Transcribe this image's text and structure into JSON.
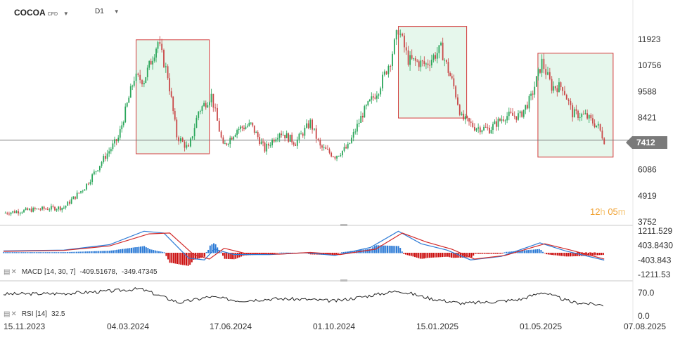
{
  "header": {
    "symbol": "COCOA",
    "symbol_suffix": "CFD",
    "timeframe": "D1"
  },
  "price_tag": "7412",
  "timer": {
    "hours": "12",
    "h_unit": "h",
    "minutes": "05",
    "m_unit": "m"
  },
  "macd_label": {
    "name": "MACD [14, 30, 7]",
    "v1": "-409.51678,",
    "v2": "-349.47345"
  },
  "rsi_label": {
    "name": "RSI [14]",
    "value": "32.5"
  },
  "colors": {
    "up": "#2aa65a",
    "down": "#c94848",
    "box_fill": "#e6f7ec",
    "box_stroke": "#d23a3a",
    "macd_line": "#2d7bd6",
    "signal_line": "#d12a2a",
    "hist_pos": "#2d7bd6",
    "hist_neg": "#cc1111",
    "rsi_line": "#222222"
  },
  "chart_data": [
    {
      "type": "candlestick",
      "title": "COCOA",
      "x_tick_labels": [
        "15.11.2023",
        "04.03.2024",
        "17.06.2024",
        "01.10.2024",
        "15.01.2025",
        "01.05.2025",
        "07.08.2025"
      ],
      "y_ticks": [
        11923,
        10756,
        9588,
        8421,
        7412,
        6086,
        4919,
        3752
      ],
      "ylim": [
        3752,
        12700
      ],
      "current_price": 7412,
      "close_series": [
        {
          "date": "2023-11-15",
          "close": 4150
        },
        {
          "date": "2023-12-15",
          "close": 4300
        },
        {
          "date": "2024-01-15",
          "close": 4400
        },
        {
          "date": "2024-02-05",
          "close": 5300
        },
        {
          "date": "2024-02-26",
          "close": 6700
        },
        {
          "date": "2024-03-10",
          "close": 7500
        },
        {
          "date": "2024-03-26",
          "close": 10200
        },
        {
          "date": "2024-04-05",
          "close": 10100
        },
        {
          "date": "2024-04-19",
          "close": 11800
        },
        {
          "date": "2024-04-29",
          "close": 10300
        },
        {
          "date": "2024-05-08",
          "close": 7600
        },
        {
          "date": "2024-05-20",
          "close": 7000
        },
        {
          "date": "2024-05-30",
          "close": 8700
        },
        {
          "date": "2024-06-12",
          "close": 9400
        },
        {
          "date": "2024-06-24",
          "close": 7100
        },
        {
          "date": "2024-07-08",
          "close": 7900
        },
        {
          "date": "2024-07-22",
          "close": 8100
        },
        {
          "date": "2024-08-05",
          "close": 7000
        },
        {
          "date": "2024-08-20",
          "close": 7800
        },
        {
          "date": "2024-09-05",
          "close": 7300
        },
        {
          "date": "2024-09-20",
          "close": 8200
        },
        {
          "date": "2024-09-30",
          "close": 7100
        },
        {
          "date": "2024-10-15",
          "close": 6700
        },
        {
          "date": "2024-10-28",
          "close": 7100
        },
        {
          "date": "2024-11-12",
          "close": 8600
        },
        {
          "date": "2024-11-28",
          "close": 9700
        },
        {
          "date": "2024-12-10",
          "close": 11000
        },
        {
          "date": "2024-12-18",
          "close": 12400
        },
        {
          "date": "2024-12-28",
          "close": 11000
        },
        {
          "date": "2025-01-15",
          "close": 10800
        },
        {
          "date": "2025-01-30",
          "close": 11500
        },
        {
          "date": "2025-02-12",
          "close": 9800
        },
        {
          "date": "2025-02-20",
          "close": 8400
        },
        {
          "date": "2025-03-05",
          "close": 8000
        },
        {
          "date": "2025-03-20",
          "close": 7900
        },
        {
          "date": "2025-04-05",
          "close": 8500
        },
        {
          "date": "2025-04-20",
          "close": 8500
        },
        {
          "date": "2025-05-01",
          "close": 9300
        },
        {
          "date": "2025-05-12",
          "close": 10900
        },
        {
          "date": "2025-05-22",
          "close": 9800
        },
        {
          "date": "2025-06-02",
          "close": 9800
        },
        {
          "date": "2025-06-12",
          "close": 8600
        },
        {
          "date": "2025-06-25",
          "close": 8500
        },
        {
          "date": "2025-07-08",
          "close": 8000
        },
        {
          "date": "2025-07-14",
          "close": 7412
        }
      ],
      "highlight_boxes": [
        {
          "from": "2024-03-28",
          "to": "2024-06-10",
          "price_low": 6800,
          "price_high": 11900
        },
        {
          "from": "2024-12-18",
          "to": "2025-02-25",
          "price_low": 8400,
          "price_high": 12500
        },
        {
          "from": "2025-05-08",
          "to": "2025-07-23",
          "price_low": 6650,
          "price_high": 11300
        }
      ]
    },
    {
      "type": "line",
      "title": "MACD [14, 30, 7]",
      "y_ticks": [
        1211.529,
        403.843,
        -403.843,
        -1211.53
      ],
      "y_tick_labels": [
        "1211.529",
        "403.8430",
        "-403.843",
        "-1211.53"
      ],
      "ylim": [
        -1211.53,
        1211.529
      ],
      "series": [
        {
          "name": "MACD",
          "points": [
            {
              "date": "2023-11-15",
              "value": 100
            },
            {
              "date": "2024-01-15",
              "value": 150
            },
            {
              "date": "2024-03-01",
              "value": 450
            },
            {
              "date": "2024-04-05",
              "value": 1200
            },
            {
              "date": "2024-04-25",
              "value": 1100
            },
            {
              "date": "2024-05-20",
              "value": -300
            },
            {
              "date": "2024-06-05",
              "value": -400
            },
            {
              "date": "2024-06-15",
              "value": 200
            },
            {
              "date": "2024-07-05",
              "value": -100
            },
            {
              "date": "2024-08-10",
              "value": -100
            },
            {
              "date": "2024-09-15",
              "value": 0
            },
            {
              "date": "2024-10-15",
              "value": -150
            },
            {
              "date": "2024-11-20",
              "value": 300
            },
            {
              "date": "2024-12-18",
              "value": 1200
            },
            {
              "date": "2025-01-10",
              "value": 500
            },
            {
              "date": "2025-02-05",
              "value": 150
            },
            {
              "date": "2025-03-01",
              "value": -400
            },
            {
              "date": "2025-04-01",
              "value": -200
            },
            {
              "date": "2025-05-10",
              "value": 550
            },
            {
              "date": "2025-06-05",
              "value": 100
            },
            {
              "date": "2025-07-14",
              "value": -409.51678
            }
          ]
        },
        {
          "name": "Signal",
          "points": [
            {
              "date": "2023-11-15",
              "value": 80
            },
            {
              "date": "2024-01-15",
              "value": 130
            },
            {
              "date": "2024-03-01",
              "value": 380
            },
            {
              "date": "2024-04-10",
              "value": 1050
            },
            {
              "date": "2024-05-01",
              "value": 1100
            },
            {
              "date": "2024-05-25",
              "value": -100
            },
            {
              "date": "2024-06-10",
              "value": -350
            },
            {
              "date": "2024-06-25",
              "value": 250
            },
            {
              "date": "2024-07-15",
              "value": -20
            },
            {
              "date": "2024-08-20",
              "value": -80
            },
            {
              "date": "2024-09-20",
              "value": 20
            },
            {
              "date": "2024-10-20",
              "value": -100
            },
            {
              "date": "2024-11-25",
              "value": 200
            },
            {
              "date": "2024-12-22",
              "value": 1100
            },
            {
              "date": "2025-01-15",
              "value": 600
            },
            {
              "date": "2025-02-10",
              "value": 200
            },
            {
              "date": "2025-03-05",
              "value": -350
            },
            {
              "date": "2025-04-05",
              "value": -150
            },
            {
              "date": "2025-05-15",
              "value": 500
            },
            {
              "date": "2025-06-10",
              "value": 150
            },
            {
              "date": "2025-07-14",
              "value": -349.47345
            }
          ]
        }
      ]
    },
    {
      "type": "line",
      "title": "RSI [14]",
      "y_ticks": [
        70.0,
        0.0
      ],
      "y_tick_labels": [
        "70.0",
        "0.0"
      ],
      "ylim": [
        0,
        100
      ],
      "series": [
        {
          "name": "RSI",
          "points": [
            {
              "date": "2023-11-15",
              "value": 66
            },
            {
              "date": "2024-01-15",
              "value": 68
            },
            {
              "date": "2024-03-01",
              "value": 75
            },
            {
              "date": "2024-04-01",
              "value": 82
            },
            {
              "date": "2024-05-10",
              "value": 40
            },
            {
              "date": "2024-06-10",
              "value": 58
            },
            {
              "date": "2024-07-10",
              "value": 46
            },
            {
              "date": "2024-08-15",
              "value": 52
            },
            {
              "date": "2024-09-15",
              "value": 50
            },
            {
              "date": "2024-10-15",
              "value": 45
            },
            {
              "date": "2024-11-20",
              "value": 62
            },
            {
              "date": "2024-12-18",
              "value": 76
            },
            {
              "date": "2025-01-20",
              "value": 52
            },
            {
              "date": "2025-02-20",
              "value": 38
            },
            {
              "date": "2025-03-20",
              "value": 42
            },
            {
              "date": "2025-04-20",
              "value": 50
            },
            {
              "date": "2025-05-12",
              "value": 72
            },
            {
              "date": "2025-06-10",
              "value": 42
            },
            {
              "date": "2025-07-14",
              "value": 32.5
            }
          ]
        }
      ]
    }
  ]
}
